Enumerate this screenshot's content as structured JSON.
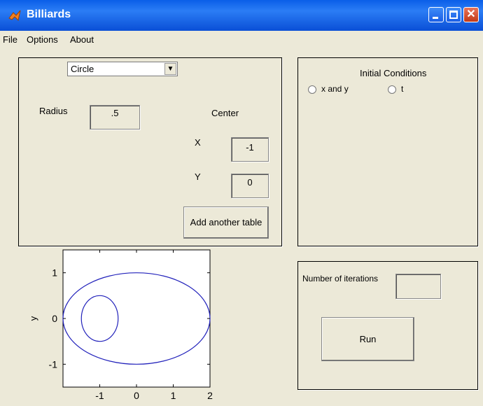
{
  "window": {
    "title": "Billiards"
  },
  "menu": {
    "items": [
      "File",
      "Options",
      "About"
    ]
  },
  "table_panel": {
    "shape_select": "Circle",
    "radius_label": "Radius",
    "radius_value": ".5",
    "center_label": "Center",
    "x_label": "X",
    "x_value": "-1",
    "y_label": "Y",
    "y_value": "0",
    "add_button": "Add another table"
  },
  "initial_panel": {
    "title": "Initial Conditions",
    "option_xy": "x and y",
    "option_t": "t"
  },
  "run_panel": {
    "iterations_label": "Number of iterations",
    "iterations_value": "",
    "run_button": "Run"
  },
  "plot": {
    "ylabel": "y",
    "xticks": [
      "-1",
      "0",
      "1",
      "2"
    ],
    "yticks": [
      "1",
      "0",
      "-1"
    ],
    "xlim": [
      -2,
      2
    ],
    "ylim": [
      -1.5,
      1.5
    ],
    "colors": {
      "curve": "#2222bb"
    },
    "ellipse": {
      "cx": 0,
      "cy": 0,
      "rx": 2,
      "ry": 1
    },
    "circle": {
      "cx": -1,
      "cy": 0,
      "r": 0.5
    }
  }
}
